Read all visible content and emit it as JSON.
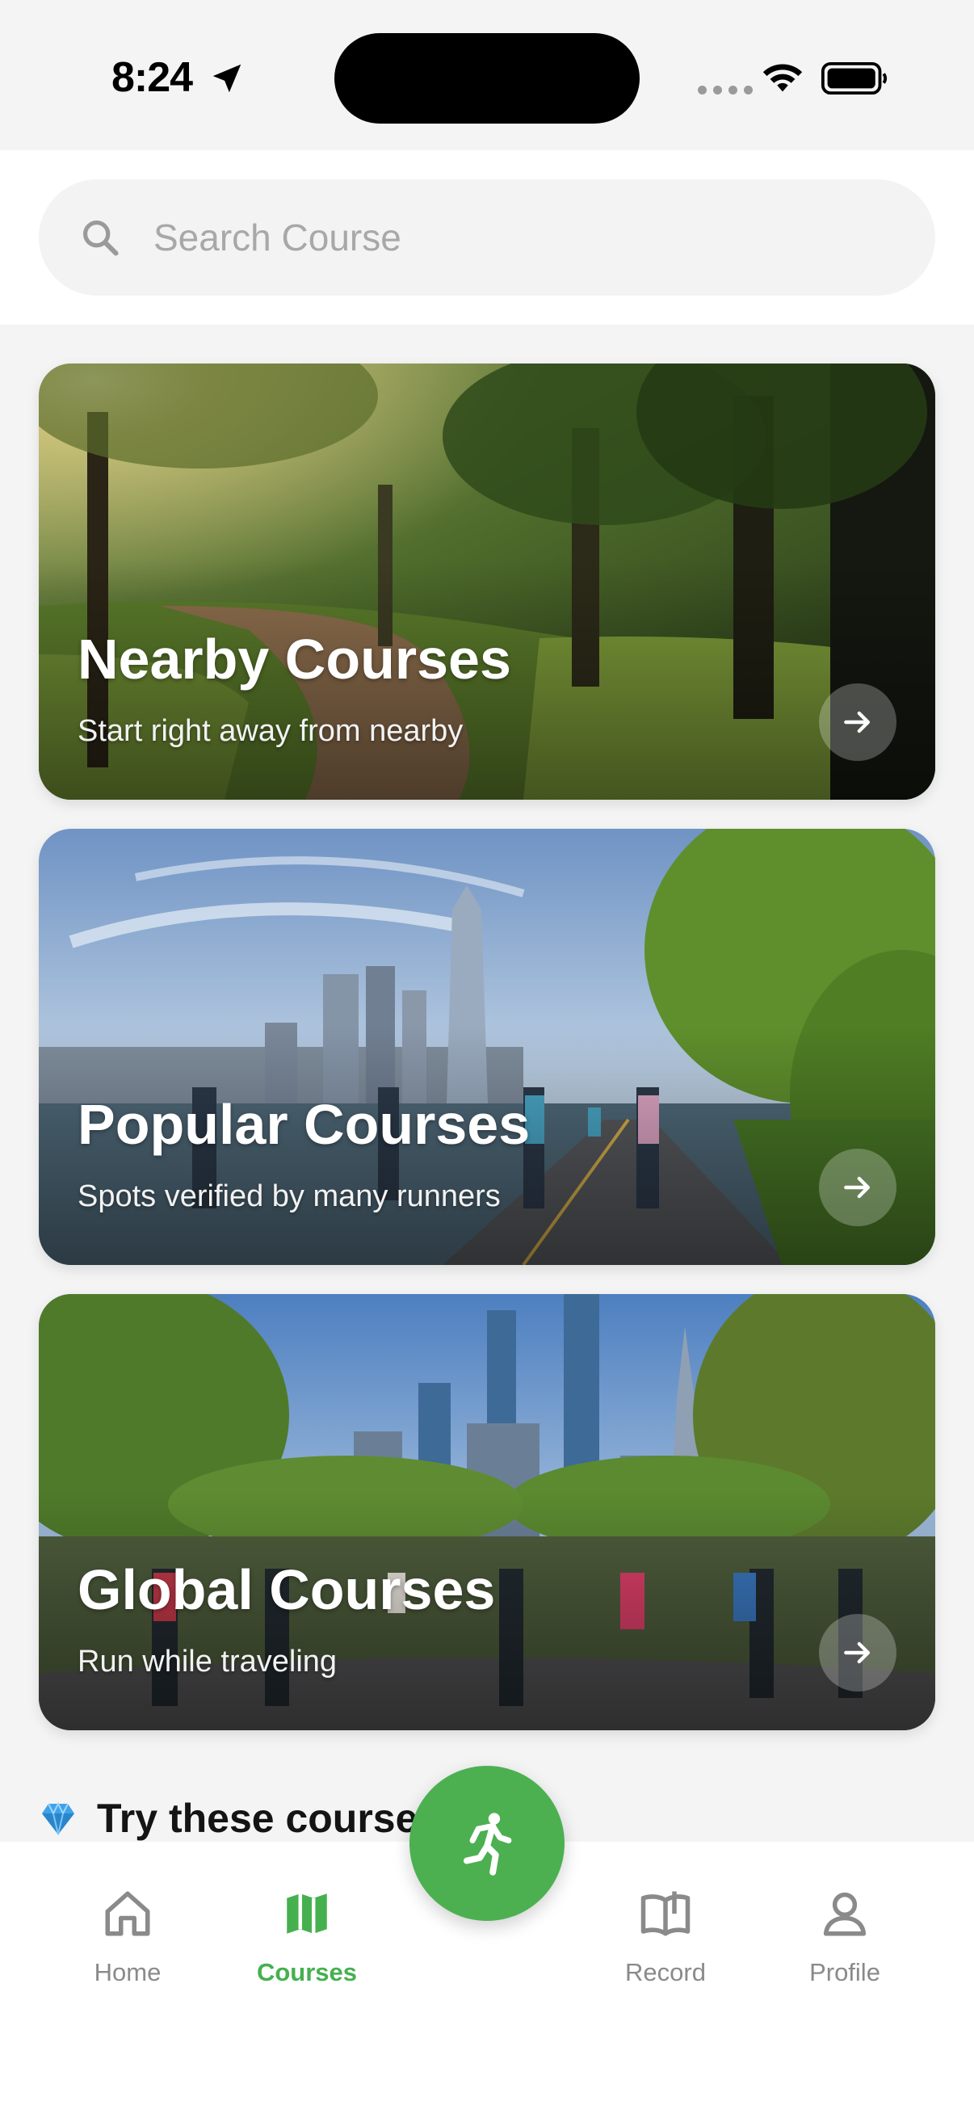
{
  "status_bar": {
    "time": "8:24",
    "icons": [
      "location-arrow-icon",
      "signal-icon",
      "wifi-icon",
      "battery-icon"
    ]
  },
  "search": {
    "placeholder": "Search Course",
    "value": ""
  },
  "cards": [
    {
      "title": "Nearby Courses",
      "subtitle": "Start right away from nearby"
    },
    {
      "title": "Popular Courses",
      "subtitle": "Spots verified by many runners"
    },
    {
      "title": "Global Courses",
      "subtitle": "Run while traveling"
    }
  ],
  "section": {
    "title": "Try these courses",
    "icon": "gem-icon"
  },
  "nav": {
    "items": [
      {
        "label": "Home",
        "icon": "home-icon"
      },
      {
        "label": "Courses",
        "icon": "map-icon",
        "active": true
      },
      {
        "label": "Record",
        "icon": "book-icon"
      },
      {
        "label": "Profile",
        "icon": "person-icon"
      }
    ],
    "fab_icon": "runner-icon"
  },
  "colors": {
    "accent": "#4cb050",
    "active_label": "#46b04f",
    "inactive_label": "#8a8a8a"
  }
}
